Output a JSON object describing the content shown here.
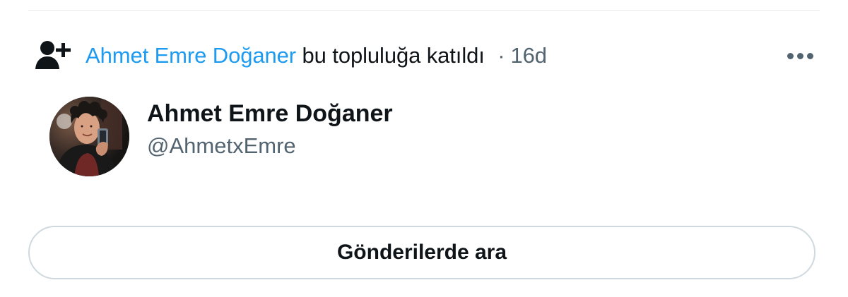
{
  "activity": {
    "actor_name": "Ahmet Emre Doğaner",
    "action_text": "bu topluluğa katıldı",
    "separator": "·",
    "time_ago": "16d",
    "icon": "user-plus-icon",
    "more_icon": "more-horizontal-icon"
  },
  "profile": {
    "display_name": "Ahmet Emre Doğaner",
    "handle": "@AhmetxEmre",
    "avatar_icon": "profile-avatar"
  },
  "search_button": {
    "label": "Gönderilerde ara"
  },
  "colors": {
    "link": "#1d9bf0",
    "text": "#0f1419",
    "muted": "#536471",
    "border": "#cfd9de",
    "divider": "#e8ecef"
  }
}
